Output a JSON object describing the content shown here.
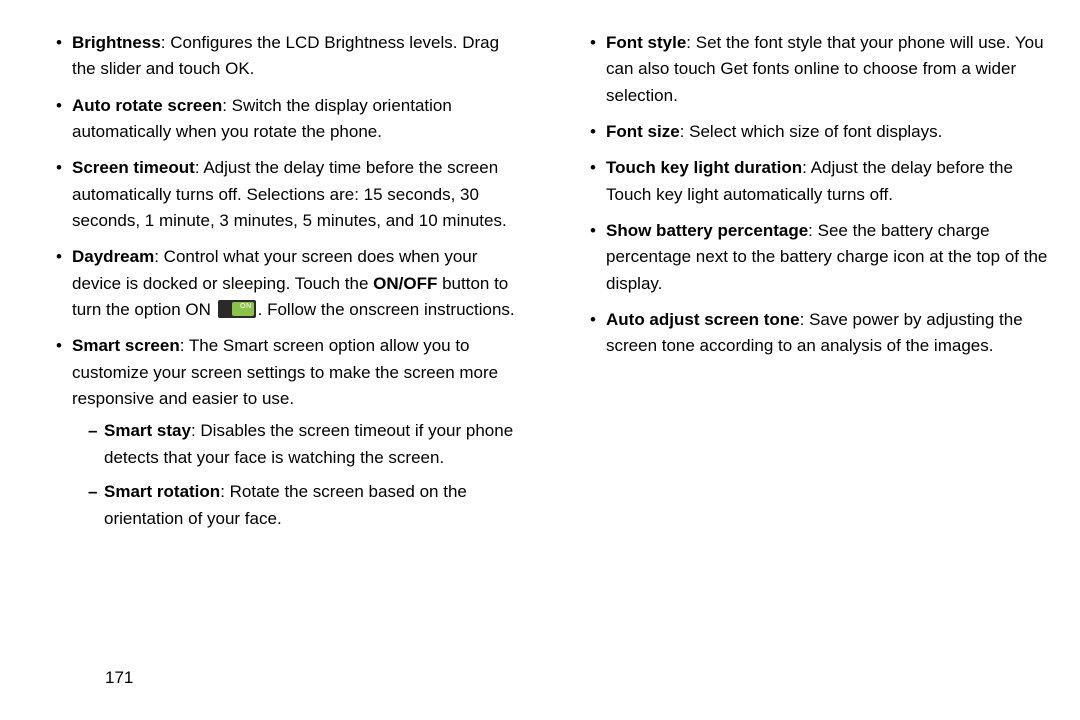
{
  "page_number": "171",
  "toggle_state_label": "ON",
  "left_column": [
    {
      "term": "Brightness",
      "desc": ": Configures the LCD Brightness levels. Drag the slider and touch OK."
    },
    {
      "term": "Auto rotate screen",
      "desc": ": Switch the display orientation automatically when you rotate the phone."
    },
    {
      "term": "Screen timeout",
      "desc": ": Adjust the delay time before the screen automatically turns off. Selections are: 15 seconds, 30 seconds, 1 minute, 3 minutes, 5 minutes, and 10 minutes."
    },
    {
      "term": "Daydream",
      "desc_pre": ": Control what your screen does when your device is docked or sleeping. Touch the ",
      "onoff": "ON/OFF",
      "desc_mid": " button to turn the option ON ",
      "desc_post": ". Follow the onscreen instructions."
    },
    {
      "term": "Smart screen",
      "desc": ": The Smart screen option allow you to customize your screen settings to make the screen more responsive and easier to use.",
      "sub": [
        {
          "term": "Smart stay",
          "desc": ": Disables the screen timeout if your phone detects that your face is watching the screen."
        },
        {
          "term": "Smart rotation",
          "desc": ": Rotate the screen based on the orientation of your face."
        }
      ]
    }
  ],
  "right_column": [
    {
      "term": "Font style",
      "desc": ": Set the font style that your phone will use. You can also touch Get fonts online to choose from a wider selection."
    },
    {
      "term": "Font size",
      "desc": ": Select which size of font displays."
    },
    {
      "term": "Touch key light duration",
      "desc": ": Adjust the delay before the Touch key light automatically turns off."
    },
    {
      "term": "Show battery percentage",
      "desc": ": See the battery charge percentage next to the battery charge icon at the top of the display."
    },
    {
      "term": "Auto adjust screen tone",
      "desc": ": Save power by adjusting the screen tone according to an analysis of the images."
    }
  ]
}
